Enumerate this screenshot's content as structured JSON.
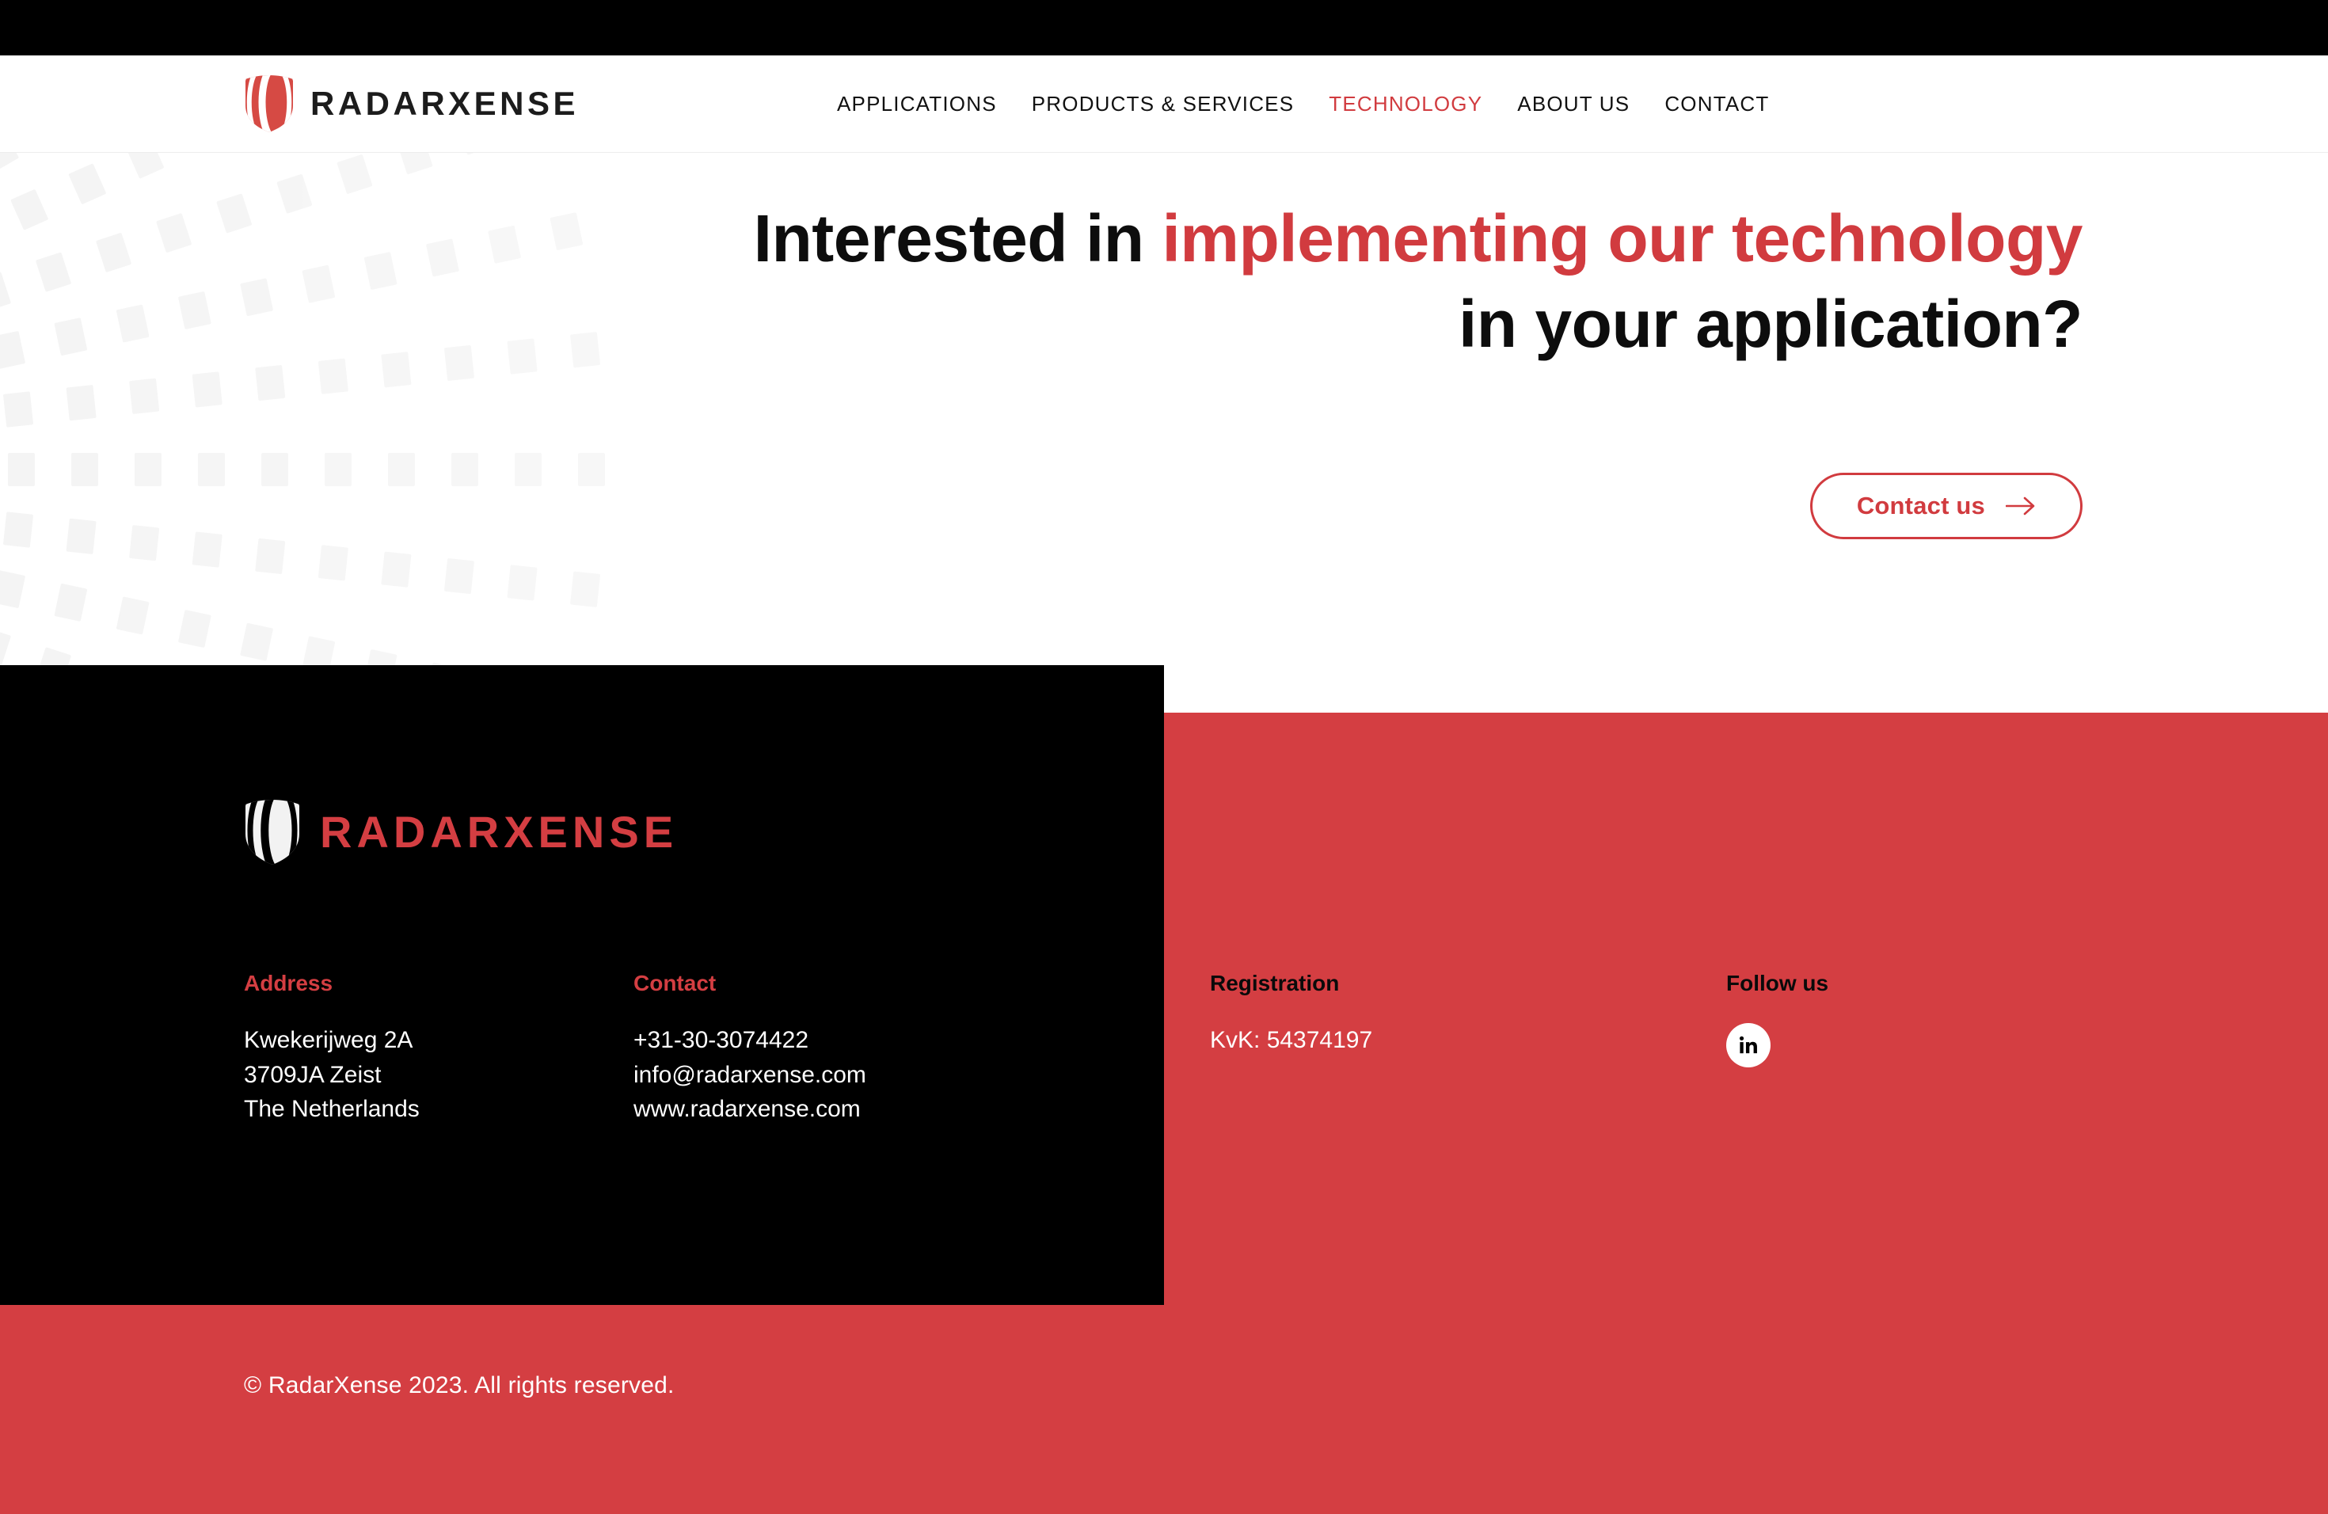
{
  "theme": {
    "brand_red": "#d43e42",
    "accent_red": "#d13b3f",
    "black": "#000000",
    "white": "#ffffff"
  },
  "header": {
    "logo_text": "RADARXENSE",
    "logo_icon": "radar-shield-icon",
    "nav": [
      {
        "label": "APPLICATIONS",
        "active": false
      },
      {
        "label": "PRODUCTS & SERVICES",
        "active": false
      },
      {
        "label": "TECHNOLOGY",
        "active": true
      },
      {
        "label": "ABOUT US",
        "active": false
      },
      {
        "label": "CONTACT",
        "active": false
      }
    ]
  },
  "hero": {
    "title_part1": "Interested in ",
    "title_accent1": "implementing our technology",
    "title_part2": " in your application?",
    "cta_label": "Contact us",
    "cta_icon": "arrow-right-icon"
  },
  "footer": {
    "logo_text": "RADARXENSE",
    "logo_icon": "radar-shield-icon",
    "columns": {
      "address": {
        "heading": "Address",
        "lines": [
          "Kwekerijweg 2A",
          "3709JA Zeist",
          "The Netherlands"
        ]
      },
      "contact": {
        "heading": "Contact",
        "lines": [
          "+31-30-3074422",
          "info@radarxense.com",
          "www.radarxense.com"
        ]
      },
      "registration": {
        "heading": "Registration",
        "lines": [
          "KvK: 54374197"
        ]
      },
      "follow": {
        "heading": "Follow us",
        "social": [
          {
            "name": "linkedin-icon",
            "label": "in"
          }
        ]
      }
    },
    "copyright": "© RadarXense 2023. All rights reserved."
  }
}
